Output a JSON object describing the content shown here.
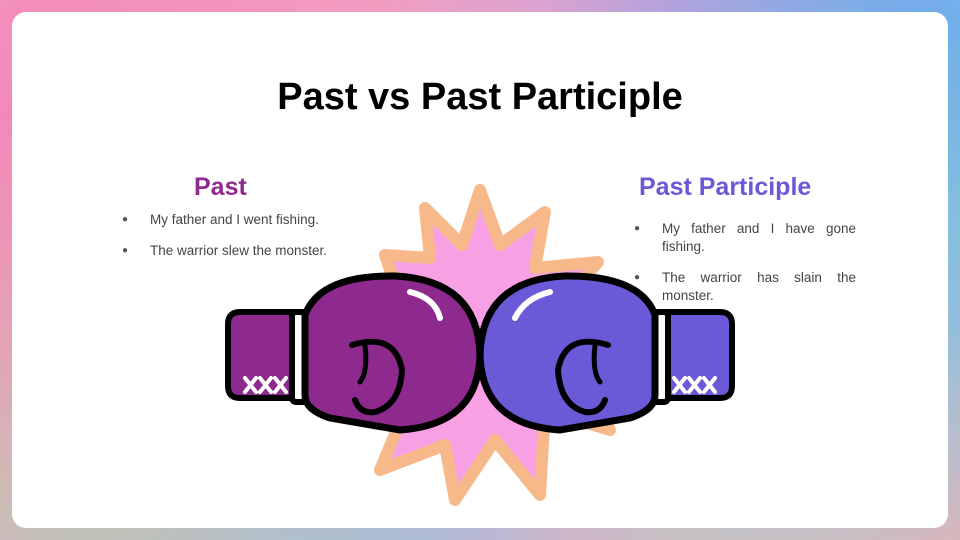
{
  "slide": {
    "title": "Past vs Past Participle"
  },
  "past": {
    "heading": "Past",
    "heading_color": "#8e2a8e",
    "items": [
      "My father and I went fishing.",
      "The warrior slew the monster."
    ]
  },
  "past_participle": {
    "heading": "Past Participle",
    "heading_color": "#6a5ad8",
    "items": [
      "My father and I have gone fishing.",
      "The warrior has slain the monster."
    ]
  },
  "illustration": {
    "icons": [
      "boxing-glove-left-icon",
      "boxing-glove-right-icon",
      "impact-burst-icon"
    ],
    "colors": {
      "left_glove": "#8e2a8e",
      "right_glove": "#6a5ad8",
      "burst_fill": "#f7a1e4",
      "burst_outline": "#f7b98a"
    }
  }
}
